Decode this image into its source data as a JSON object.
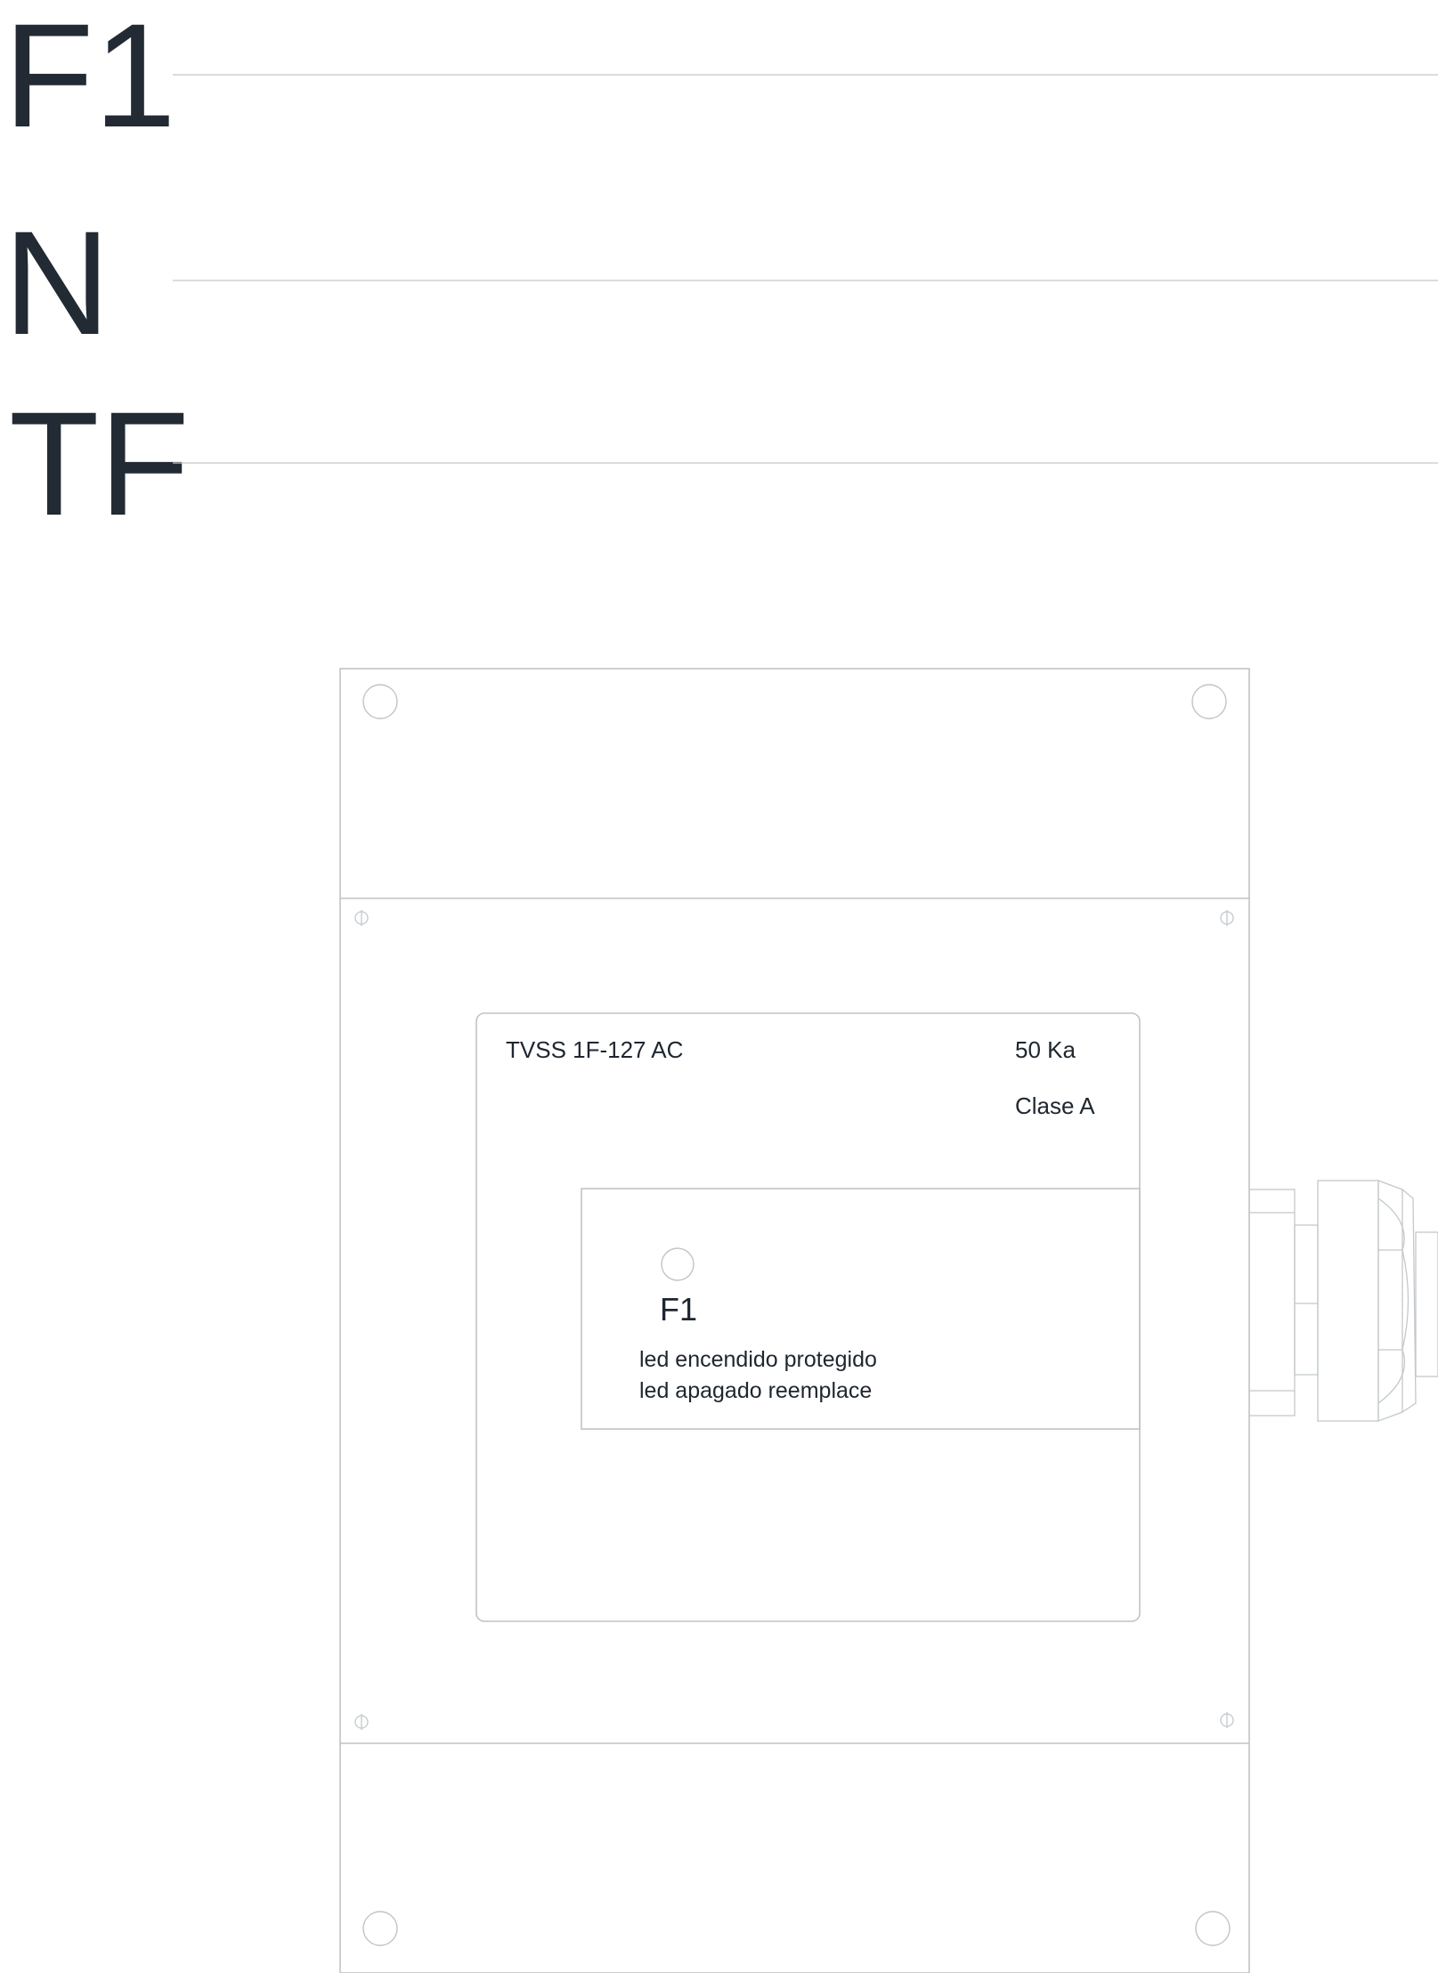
{
  "buses": [
    {
      "label": "F1"
    },
    {
      "label": "N"
    },
    {
      "label": "TF"
    }
  ],
  "device": {
    "model": "TVSS 1F-127 AC",
    "rating": "50 Ka",
    "class": "Clase A",
    "indicator": {
      "label": "F1",
      "line1": "led encendido protegido",
      "line2": "led apagado reemplace"
    }
  },
  "colors": {
    "text": "#222a33",
    "lines": "#bfc3c7",
    "background": "#ffffff"
  }
}
